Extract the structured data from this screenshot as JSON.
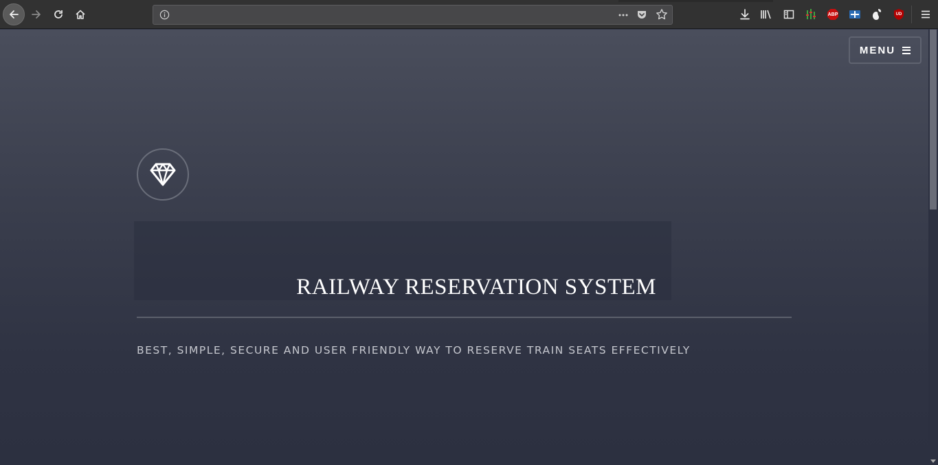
{
  "browser": {
    "url_value": "",
    "nav_icons": [
      "back-arrow-icon",
      "forward-arrow-icon",
      "reload-icon",
      "home-icon"
    ],
    "urlbar_icons": [
      "info-icon",
      "page-actions-icon",
      "pocket-icon",
      "bookmark-star-icon"
    ],
    "toolbar_icons": [
      "download-icon",
      "library-icon",
      "sidebar-icon",
      "equalizer-extension-icon",
      "adblock-plus-icon",
      "extension-icon",
      "gnome-extension-icon",
      "ublock-origin-icon",
      "app-menu-icon"
    ],
    "adblock_label": "ABP",
    "ublock_label": "UD"
  },
  "header": {
    "menu_label": "MENU"
  },
  "hero": {
    "logo_icon": "diamond-icon",
    "title": "RAILWAY RESERVATION SYSTEM",
    "subtitle": "BEST, SIMPLE, SECURE AND USER FRIENDLY WAY TO RESERVE TRAIN SEATS EFFECTIVELY"
  },
  "colors": {
    "page_top": "#4a4e5c",
    "page_bottom": "#2c3040",
    "title": "#ffffff",
    "subtitle": "#c6c8cf",
    "adblock_red": "#c80f0f",
    "ublock_red": "#b30000"
  }
}
